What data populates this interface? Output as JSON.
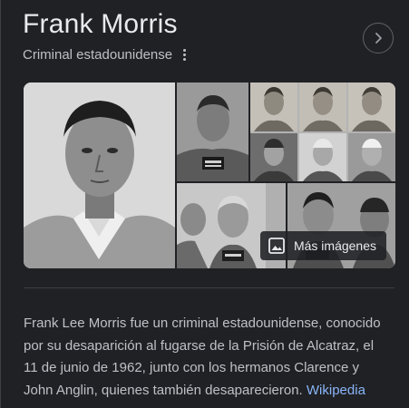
{
  "header": {
    "title": "Frank Morris",
    "subtitle": "Criminal estadounidense"
  },
  "icons": {
    "next": "chevron-right-icon",
    "menu": "more-vert-icon",
    "images": "image-icon"
  },
  "gallery": {
    "more_images_label": "Más imágenes"
  },
  "description": {
    "text": "Frank Lee Morris fue un criminal estadounidense, conocido por su desaparición al fugarse de la Prisión de Alcatraz, el 11 de junio de 1962, junto con los hermanos Clarence y John Anglin, quienes también desaparecieron.",
    "source_link": "Wikipedia"
  },
  "colors": {
    "background": "#202124",
    "title": "#e8eaed",
    "text": "#bdc1c6",
    "link": "#8ab4f8"
  }
}
